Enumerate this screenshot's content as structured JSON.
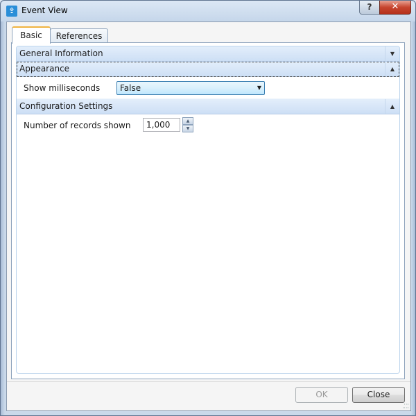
{
  "window": {
    "title": "Event View",
    "app_icon": "upload-icon",
    "help_glyph": "?",
    "close_glyph": "✕"
  },
  "tabs": [
    {
      "label": "Basic",
      "active": true
    },
    {
      "label": "References",
      "active": false
    }
  ],
  "sections": [
    {
      "label": "General Information",
      "toggle_glyph": "▼",
      "expanded": false
    },
    {
      "label": "Appearance",
      "toggle_glyph": "▲",
      "expanded": true,
      "focused": true,
      "fields": [
        {
          "label": "Show milliseconds",
          "type": "combo",
          "value": "False"
        }
      ]
    },
    {
      "label": "Configuration Settings",
      "toggle_glyph": "▲",
      "expanded": true,
      "fields": [
        {
          "label": "Number of records shown",
          "type": "spinner",
          "value": "1,000"
        }
      ]
    }
  ],
  "spinner": {
    "up_glyph": "▲",
    "down_glyph": "▼"
  },
  "combo_arrow": "▼",
  "buttons": {
    "ok": "OK",
    "ok_enabled": false,
    "close": "Close"
  }
}
